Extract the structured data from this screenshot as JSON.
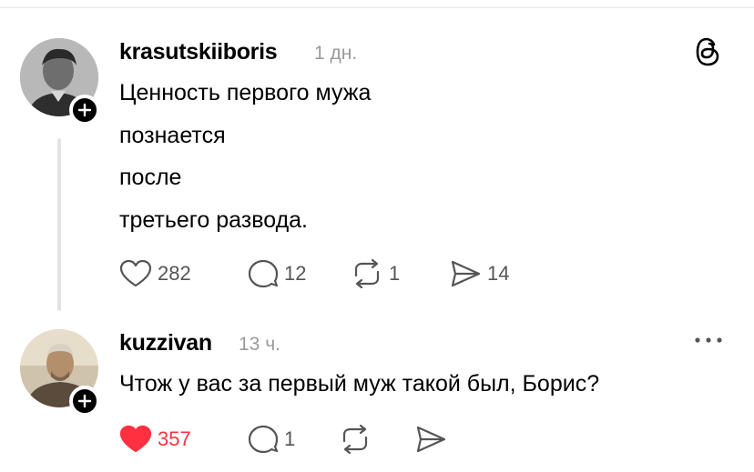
{
  "posts": [
    {
      "username": "krasutskiiboris",
      "timestamp": "1 дн.",
      "body_lines": [
        "Ценность первого мужа",
        "познается",
        "после",
        "третьего развода."
      ],
      "actions": {
        "likes": "282",
        "replies": "12",
        "reposts": "1",
        "shares": "14"
      },
      "liked": false,
      "corner_icon": "threads-logo-icon"
    },
    {
      "username": "kuzzivan",
      "timestamp": "13 ч.",
      "body_lines": [
        "Чтож у вас за первый муж такой был, Борис?"
      ],
      "actions": {
        "likes": "357",
        "replies": "1",
        "reposts": "",
        "shares": ""
      },
      "liked": true,
      "corner_icon": "more-dots-icon"
    }
  ],
  "colors": {
    "like_active": "#ff3040",
    "muted_text": "#9a9a9a",
    "icon_gray": "#555555",
    "thread_line": "#e3e3e3"
  }
}
